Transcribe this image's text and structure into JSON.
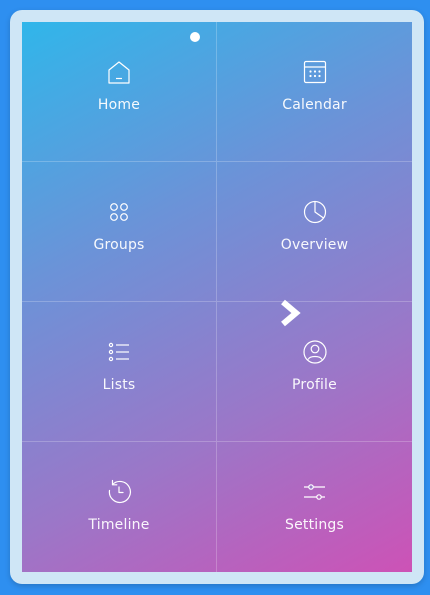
{
  "menu": {
    "items": [
      {
        "label": "Home",
        "icon": "home-icon"
      },
      {
        "label": "Calendar",
        "icon": "calendar-icon"
      },
      {
        "label": "Groups",
        "icon": "groups-icon"
      },
      {
        "label": "Overview",
        "icon": "pie-chart-icon"
      },
      {
        "label": "Lists",
        "icon": "list-icon"
      },
      {
        "label": "Profile",
        "icon": "user-icon"
      },
      {
        "label": "Timeline",
        "icon": "history-icon"
      },
      {
        "label": "Settings",
        "icon": "sliders-icon"
      }
    ]
  },
  "colors": {
    "gradient_start": "#30b6ea",
    "gradient_end": "#cd52b6",
    "background": "#2e8ff0",
    "frame": "#cfe6f6"
  }
}
